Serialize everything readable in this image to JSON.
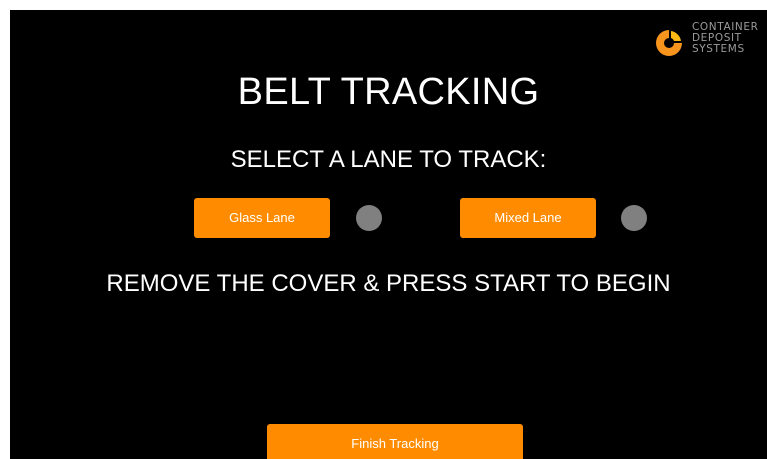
{
  "logo": {
    "line1": "CONTAINER",
    "line2": "DEPOSIT",
    "line3": "SYSTEMS",
    "icon": "cds-logo-icon",
    "colors": {
      "outer": "#f7941d",
      "inner": "#fdb913"
    }
  },
  "title": "BELT TRACKING",
  "subtitle": "SELECT A LANE TO TRACK:",
  "lanes": [
    {
      "label": "Glass Lane",
      "indicator_color": "#808080"
    },
    {
      "label": "Mixed Lane",
      "indicator_color": "#808080"
    }
  ],
  "instruction": "REMOVE THE COVER & PRESS START TO BEGIN",
  "finish_button": "Finish Tracking",
  "colors": {
    "background": "#000000",
    "accent": "#ff8c00",
    "text": "#ffffff",
    "indicator_idle": "#808080"
  }
}
